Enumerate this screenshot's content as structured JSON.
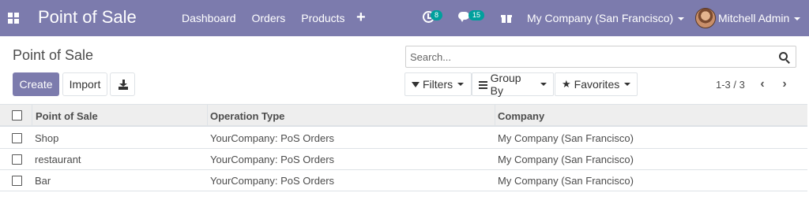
{
  "navbar": {
    "app_title": "Point of Sale",
    "menu": [
      "Dashboard",
      "Orders",
      "Products"
    ],
    "add_label": "+",
    "activity_count": "8",
    "messages_count": "15",
    "company": "My Company (San Francisco)",
    "user": "Mitchell Admin",
    "accent_color": "#7c7bad",
    "badge_color": "#00a09d"
  },
  "control_panel": {
    "breadcrumb": "Point of Sale",
    "search_placeholder": "Search...",
    "create_label": "Create",
    "import_label": "Import",
    "filters_label": "Filters",
    "group_by_label": "Group By",
    "favorites_label": "Favorites",
    "pager": "1-3 / 3"
  },
  "table": {
    "columns": [
      "Point of Sale",
      "Operation Type",
      "Company"
    ],
    "rows": [
      {
        "name": "Shop",
        "operation_type": "YourCompany: PoS Orders",
        "company": "My Company (San Francisco)"
      },
      {
        "name": "restaurant",
        "operation_type": "YourCompany: PoS Orders",
        "company": "My Company (San Francisco)"
      },
      {
        "name": "Bar",
        "operation_type": "YourCompany: PoS Orders",
        "company": "My Company (San Francisco)"
      }
    ]
  }
}
